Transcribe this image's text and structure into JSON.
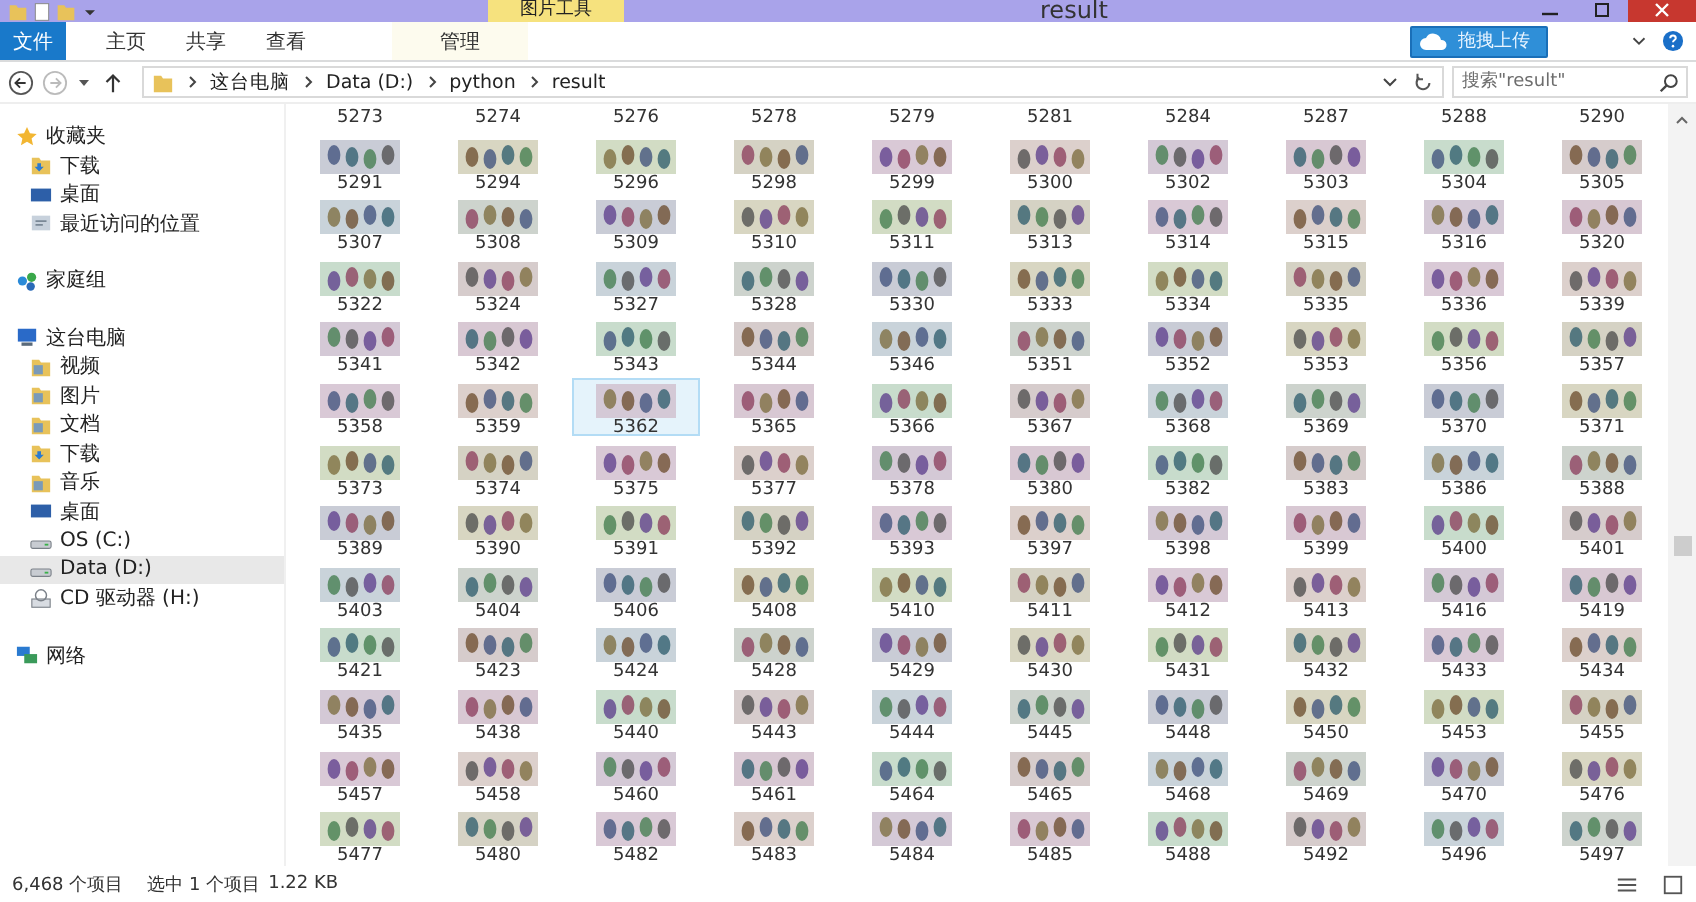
{
  "window": {
    "title": "result"
  },
  "ribbon": {
    "context_tab": "图片工具",
    "tabs": [
      {
        "label": "文件",
        "kind": "file_menu",
        "selected": false
      },
      {
        "label": "主页",
        "kind": "tab",
        "selected": false
      },
      {
        "label": "共享",
        "kind": "tab",
        "selected": false
      },
      {
        "label": "查看",
        "kind": "tab",
        "selected": false
      },
      {
        "label": "管理",
        "kind": "context",
        "selected": false
      }
    ],
    "upload_button": "拖拽上传"
  },
  "address_bar": {
    "breadcrumbs": [
      "这台电脑",
      "Data (D:)",
      "python",
      "result"
    ],
    "search": {
      "placeholder": "搜索\"result\""
    }
  },
  "sidebar": {
    "groups": [
      {
        "label": "收藏夹",
        "kind": "favorites",
        "selected": false,
        "children": [
          {
            "label": "下载",
            "kind": "download",
            "selected": false
          },
          {
            "label": "桌面",
            "kind": "desktop",
            "selected": false
          },
          {
            "label": "最近访问的位置",
            "kind": "recent",
            "selected": false
          }
        ]
      },
      {
        "label": "家庭组",
        "kind": "homegroup",
        "selected": false
      },
      {
        "label": "这台电脑",
        "kind": "computer",
        "selected": false,
        "children": [
          {
            "label": "视频",
            "kind": "folder",
            "selected": false
          },
          {
            "label": "图片",
            "kind": "folder",
            "selected": false
          },
          {
            "label": "文档",
            "kind": "folder",
            "selected": false
          },
          {
            "label": "下载",
            "kind": "download",
            "selected": false
          },
          {
            "label": "音乐",
            "kind": "folder",
            "selected": false
          },
          {
            "label": "桌面",
            "kind": "desktop",
            "selected": false
          },
          {
            "label": "OS (C:)",
            "kind": "drive",
            "selected": false
          },
          {
            "label": "Data (D:)",
            "kind": "drive",
            "selected": true
          },
          {
            "label": "CD 驱动器 (H:)",
            "kind": "cd",
            "selected": false
          }
        ]
      },
      {
        "label": "网络",
        "kind": "network",
        "selected": false
      }
    ]
  },
  "file_grid": {
    "cut_off_names": [
      "5273",
      "5274",
      "5276",
      "5278",
      "5279",
      "5281",
      "5284",
      "5287",
      "5288",
      "5290"
    ],
    "files": [
      {
        "name": "5291",
        "selected": false
      },
      {
        "name": "5294",
        "selected": false
      },
      {
        "name": "5296",
        "selected": false
      },
      {
        "name": "5298",
        "selected": false
      },
      {
        "name": "5299",
        "selected": false
      },
      {
        "name": "5300",
        "selected": false
      },
      {
        "name": "5302",
        "selected": false
      },
      {
        "name": "5303",
        "selected": false
      },
      {
        "name": "5304",
        "selected": false
      },
      {
        "name": "5305",
        "selected": false
      },
      {
        "name": "5307",
        "selected": false
      },
      {
        "name": "5308",
        "selected": false
      },
      {
        "name": "5309",
        "selected": false
      },
      {
        "name": "5310",
        "selected": false
      },
      {
        "name": "5311",
        "selected": false
      },
      {
        "name": "5313",
        "selected": false
      },
      {
        "name": "5314",
        "selected": false
      },
      {
        "name": "5315",
        "selected": false
      },
      {
        "name": "5316",
        "selected": false
      },
      {
        "name": "5320",
        "selected": false
      },
      {
        "name": "5322",
        "selected": false
      },
      {
        "name": "5324",
        "selected": false
      },
      {
        "name": "5327",
        "selected": false
      },
      {
        "name": "5328",
        "selected": false
      },
      {
        "name": "5330",
        "selected": false
      },
      {
        "name": "5333",
        "selected": false
      },
      {
        "name": "5334",
        "selected": false
      },
      {
        "name": "5335",
        "selected": false
      },
      {
        "name": "5336",
        "selected": false
      },
      {
        "name": "5339",
        "selected": false
      },
      {
        "name": "5341",
        "selected": false
      },
      {
        "name": "5342",
        "selected": false
      },
      {
        "name": "5343",
        "selected": false
      },
      {
        "name": "5344",
        "selected": false
      },
      {
        "name": "5346",
        "selected": false
      },
      {
        "name": "5351",
        "selected": false
      },
      {
        "name": "5352",
        "selected": false
      },
      {
        "name": "5353",
        "selected": false
      },
      {
        "name": "5356",
        "selected": false
      },
      {
        "name": "5357",
        "selected": false
      },
      {
        "name": "5358",
        "selected": false
      },
      {
        "name": "5359",
        "selected": false
      },
      {
        "name": "5362",
        "selected": true
      },
      {
        "name": "5365",
        "selected": false
      },
      {
        "name": "5366",
        "selected": false
      },
      {
        "name": "5367",
        "selected": false
      },
      {
        "name": "5368",
        "selected": false
      },
      {
        "name": "5369",
        "selected": false
      },
      {
        "name": "5370",
        "selected": false
      },
      {
        "name": "5371",
        "selected": false
      },
      {
        "name": "5373",
        "selected": false
      },
      {
        "name": "5374",
        "selected": false
      },
      {
        "name": "5375",
        "selected": false
      },
      {
        "name": "5377",
        "selected": false
      },
      {
        "name": "5378",
        "selected": false
      },
      {
        "name": "5380",
        "selected": false
      },
      {
        "name": "5382",
        "selected": false
      },
      {
        "name": "5383",
        "selected": false
      },
      {
        "name": "5386",
        "selected": false
      },
      {
        "name": "5388",
        "selected": false
      },
      {
        "name": "5389",
        "selected": false
      },
      {
        "name": "5390",
        "selected": false
      },
      {
        "name": "5391",
        "selected": false
      },
      {
        "name": "5392",
        "selected": false
      },
      {
        "name": "5393",
        "selected": false
      },
      {
        "name": "5397",
        "selected": false
      },
      {
        "name": "5398",
        "selected": false
      },
      {
        "name": "5399",
        "selected": false
      },
      {
        "name": "5400",
        "selected": false
      },
      {
        "name": "5401",
        "selected": false
      },
      {
        "name": "5403",
        "selected": false
      },
      {
        "name": "5404",
        "selected": false
      },
      {
        "name": "5406",
        "selected": false
      },
      {
        "name": "5408",
        "selected": false
      },
      {
        "name": "5410",
        "selected": false
      },
      {
        "name": "5411",
        "selected": false
      },
      {
        "name": "5412",
        "selected": false
      },
      {
        "name": "5413",
        "selected": false
      },
      {
        "name": "5416",
        "selected": false
      },
      {
        "name": "5419",
        "selected": false
      },
      {
        "name": "5421",
        "selected": false
      },
      {
        "name": "5423",
        "selected": false
      },
      {
        "name": "5424",
        "selected": false
      },
      {
        "name": "5428",
        "selected": false
      },
      {
        "name": "5429",
        "selected": false
      },
      {
        "name": "5430",
        "selected": false
      },
      {
        "name": "5431",
        "selected": false
      },
      {
        "name": "5432",
        "selected": false
      },
      {
        "name": "5433",
        "selected": false
      },
      {
        "name": "5434",
        "selected": false
      },
      {
        "name": "5435",
        "selected": false
      },
      {
        "name": "5438",
        "selected": false
      },
      {
        "name": "5440",
        "selected": false
      },
      {
        "name": "5443",
        "selected": false
      },
      {
        "name": "5444",
        "selected": false
      },
      {
        "name": "5445",
        "selected": false
      },
      {
        "name": "5448",
        "selected": false
      },
      {
        "name": "5450",
        "selected": false
      },
      {
        "name": "5453",
        "selected": false
      },
      {
        "name": "5455",
        "selected": false
      },
      {
        "name": "5457",
        "selected": false
      },
      {
        "name": "5458",
        "selected": false
      },
      {
        "name": "5460",
        "selected": false
      },
      {
        "name": "5461",
        "selected": false
      },
      {
        "name": "5464",
        "selected": false
      },
      {
        "name": "5465",
        "selected": false
      },
      {
        "name": "5468",
        "selected": false
      },
      {
        "name": "5469",
        "selected": false
      },
      {
        "name": "5470",
        "selected": false
      },
      {
        "name": "5476",
        "selected": false
      },
      {
        "name": "5477",
        "selected": false
      },
      {
        "name": "5480",
        "selected": false
      },
      {
        "name": "5482",
        "selected": false
      },
      {
        "name": "5483",
        "selected": false
      },
      {
        "name": "5484",
        "selected": false
      },
      {
        "name": "5485",
        "selected": false
      },
      {
        "name": "5488",
        "selected": false
      },
      {
        "name": "5492",
        "selected": false
      },
      {
        "name": "5496",
        "selected": false
      },
      {
        "name": "5497",
        "selected": false
      }
    ]
  },
  "status_bar": {
    "item_count": "6,468 个项目",
    "selection": "选中 1 个项目",
    "size": "1.22 KB"
  }
}
